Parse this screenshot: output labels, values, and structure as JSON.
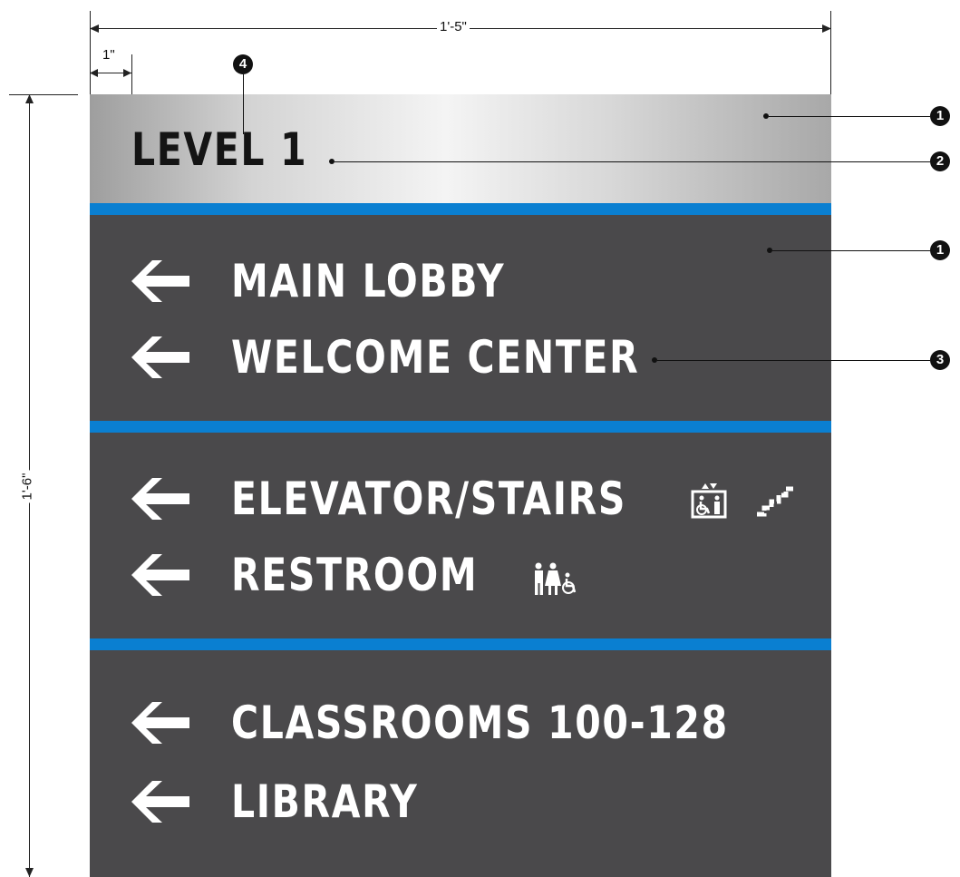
{
  "dimensions": {
    "width_label": "1'-5\"",
    "height_label": "1'-6\"",
    "margin_label": "1\""
  },
  "sign": {
    "header": {
      "title": "LEVEL 1"
    },
    "sections": [
      {
        "rows": [
          {
            "label": "MAIN LOBBY",
            "direction": "left",
            "icons": []
          },
          {
            "label": "WELCOME CENTER",
            "direction": "left",
            "icons": []
          }
        ]
      },
      {
        "rows": [
          {
            "label": "ELEVATOR/STAIRS",
            "direction": "left",
            "icons": [
              "accessible-elevator-icon",
              "stairs-icon"
            ]
          },
          {
            "label": "RESTROOM",
            "direction": "left",
            "icons": [
              "restroom-icon"
            ]
          }
        ]
      },
      {
        "rows": [
          {
            "label": "CLASSROOMS 100-128",
            "direction": "left",
            "icons": []
          },
          {
            "label": "LIBRARY",
            "direction": "left",
            "icons": []
          }
        ]
      }
    ],
    "colors": {
      "panel": "#4a494b",
      "stripe": "#0a7fd1",
      "text": "#ffffff",
      "header_text": "#141414"
    }
  },
  "callouts": [
    "1",
    "2",
    "1",
    "3",
    "4"
  ]
}
